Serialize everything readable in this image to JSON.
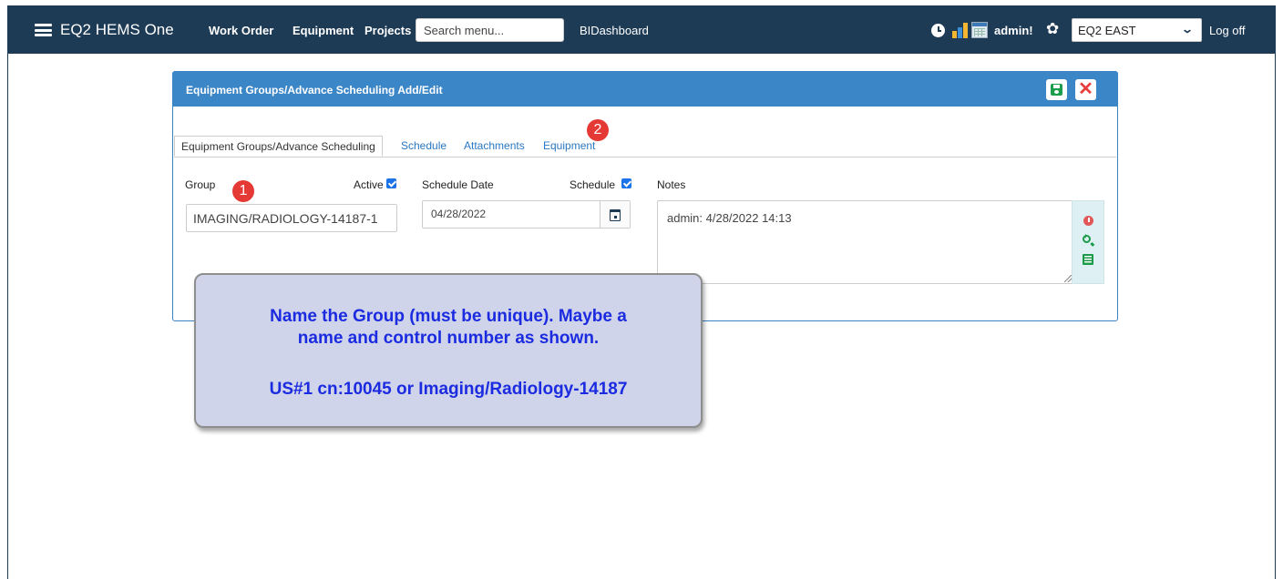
{
  "topbar": {
    "brand": "EQ2 HEMS One",
    "nav": [
      "Work Order",
      "Equipment",
      "Projects"
    ],
    "search_placeholder": "Search menu...",
    "bidashboard": "BIDashboard",
    "user": "admin!",
    "site": "EQ2 EAST",
    "logoff": "Log off",
    "colors": {
      "bar": "#1e3b56"
    }
  },
  "panel": {
    "title": "Equipment Groups/Advance Scheduling Add/Edit",
    "tabs": [
      "Equipment Groups/Advance Scheduling",
      "Schedule",
      "Attachments",
      "Equipment"
    ],
    "form": {
      "group_label": "Group",
      "active_label": "Active",
      "group_value": "IMAGING/RADIOLOGY-14187-1",
      "schedule_date_label": "Schedule Date",
      "schedule_label": "Schedule",
      "schedule_date_value": "04/28/2022",
      "notes_label": "Notes",
      "notes_value": "admin: 4/28/2022 14:13"
    },
    "colors": {
      "header": "#3b86c7",
      "save": "#1b9d4b",
      "close": "#e83c3c"
    }
  },
  "badges": [
    "1",
    "2"
  ],
  "callout": {
    "line1": "Name the Group (must be unique). Maybe a",
    "line2": "name and control number as shown.",
    "line3": "US#1 cn:10045 or Imaging/Radiology-14187"
  }
}
